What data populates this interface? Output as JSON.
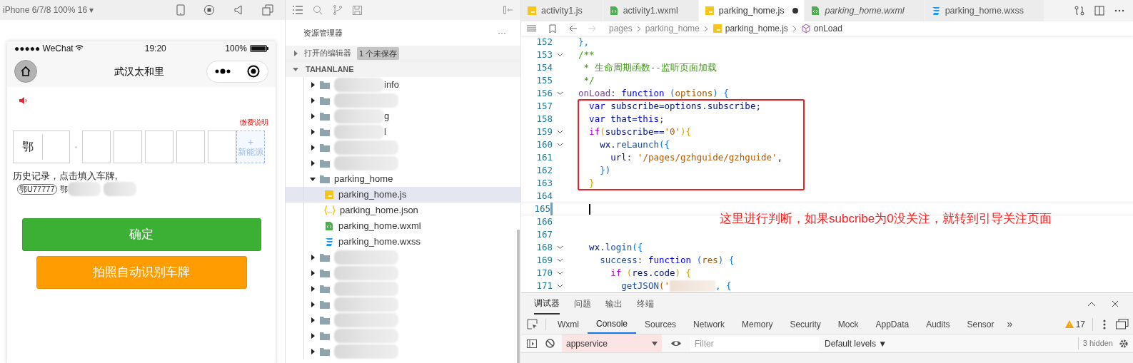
{
  "simulator": {
    "device_label": "iPhone 6/7/8 100% 16 ▾",
    "status": {
      "carrier": "●●●●● WeChat",
      "time": "19:20",
      "battery": "100%"
    },
    "nav_title": "武汉太和里",
    "fee_link": "缴费说明",
    "plate": {
      "province": "鄂",
      "new_energy_plus": "+",
      "new_energy_label": "新能源"
    },
    "history_label": "历史记录，点击填入车牌,",
    "history": [
      {
        "text": "鄂U77777",
        "redacted": false
      },
      {
        "text": "鄂",
        "redacted": true
      },
      {
        "redacted": true
      }
    ],
    "buttons": [
      {
        "label": "确定",
        "kind": "primary"
      },
      {
        "label": "拍照自动识别车牌",
        "kind": "warn"
      }
    ]
  },
  "explorer": {
    "title": "资源管理器",
    "more": "···",
    "open_editors": {
      "label": "打开的编辑器",
      "badge": "1 个未保存",
      "expanded": false
    },
    "project": {
      "label": "TAHANLANE",
      "expanded": true
    },
    "tree": [
      {
        "kind": "folder",
        "expanded": false,
        "redacted": true,
        "name": "info"
      },
      {
        "kind": "folder",
        "expanded": false,
        "redacted": true
      },
      {
        "kind": "folder",
        "expanded": false,
        "redacted": true,
        "name": "g"
      },
      {
        "kind": "folder",
        "expanded": false,
        "redacted": true,
        "name": "l"
      },
      {
        "kind": "folder",
        "expanded": false,
        "redacted": true
      },
      {
        "kind": "folder",
        "expanded": false,
        "redacted": true
      },
      {
        "kind": "folder",
        "expanded": true,
        "redacted": false,
        "name": "parking_home",
        "children": [
          {
            "kind": "js",
            "name": "parking_home.js",
            "selected": true
          },
          {
            "kind": "json",
            "name": "parking_home.json",
            "selected": false
          },
          {
            "kind": "wxml",
            "name": "parking_home.wxml",
            "selected": false
          },
          {
            "kind": "wxss",
            "name": "parking_home.wxss",
            "selected": false
          }
        ]
      },
      {
        "kind": "folder",
        "expanded": false,
        "redacted": true
      },
      {
        "kind": "folder",
        "expanded": false,
        "redacted": true
      },
      {
        "kind": "folder",
        "expanded": false,
        "redacted": true
      },
      {
        "kind": "folder",
        "expanded": false,
        "redacted": true
      },
      {
        "kind": "folder",
        "expanded": false,
        "redacted": true
      },
      {
        "kind": "folder",
        "expanded": false,
        "redacted": true
      },
      {
        "kind": "folder",
        "expanded": false,
        "redacted": true
      }
    ]
  },
  "editor": {
    "tabs": [
      {
        "label": "activity1.js",
        "kind": "js",
        "selected": false,
        "modified": false,
        "preview": false
      },
      {
        "label": "activity1.wxml",
        "kind": "wxml",
        "selected": false,
        "modified": false,
        "preview": false
      },
      {
        "label": "parking_home.js",
        "kind": "js",
        "selected": true,
        "modified": true,
        "preview": false
      },
      {
        "label": "parking_home.wxml",
        "kind": "wxml",
        "selected": false,
        "modified": false,
        "preview": true
      },
      {
        "label": "parking_home.wxss",
        "kind": "wxss",
        "selected": false,
        "modified": false,
        "preview": false
      }
    ],
    "breadcrumb": [
      {
        "text": "pages",
        "kind": "folder"
      },
      {
        "text": "parking_home",
        "kind": "folder"
      },
      {
        "text": "parking_home.js",
        "kind": "js"
      },
      {
        "text": "onLoad",
        "kind": "method"
      }
    ],
    "lines": [
      {
        "number": "152",
        "fold": false,
        "current": false,
        "tokens": [
          {
            "text": "  },",
            "kind": "bracket"
          }
        ]
      },
      {
        "number": "153",
        "fold": true,
        "current": false,
        "tokens": [
          {
            "text": "  /**",
            "kind": "comment"
          }
        ]
      },
      {
        "number": "154",
        "fold": false,
        "current": false,
        "tokens": [
          {
            "text": "   * 生命周期函数--监听页面加载",
            "kind": "comment"
          }
        ]
      },
      {
        "number": "155",
        "fold": false,
        "current": false,
        "tokens": [
          {
            "text": "   */",
            "kind": "comment"
          }
        ]
      },
      {
        "number": "156",
        "fold": true,
        "current": false,
        "tokens": [
          {
            "text": "  onLoad",
            "kind": "method"
          },
          {
            "text": ": ",
            "kind": "plain"
          },
          {
            "text": "function",
            "kind": "keyword"
          },
          {
            "text": " (",
            "kind": "bracket"
          },
          {
            "text": "options",
            "kind": "param"
          },
          {
            "text": ") {",
            "kind": "bracket"
          }
        ]
      },
      {
        "number": "157",
        "fold": false,
        "current": false,
        "tokens": [
          {
            "text": "    var",
            "kind": "keyword"
          },
          {
            "text": " subscribe=options.subscribe;",
            "kind": "variable"
          }
        ]
      },
      {
        "number": "158",
        "fold": false,
        "current": false,
        "tokens": [
          {
            "text": "    var",
            "kind": "keyword"
          },
          {
            "text": " that=",
            "kind": "variable"
          },
          {
            "text": "this",
            "kind": "keyword"
          },
          {
            "text": ";",
            "kind": "plain"
          }
        ]
      },
      {
        "number": "159",
        "fold": true,
        "current": false,
        "tokens": [
          {
            "text": "    if",
            "kind": "control"
          },
          {
            "text": "(",
            "kind": "gold"
          },
          {
            "text": "subscribe==",
            "kind": "variable"
          },
          {
            "text": "'0'",
            "kind": "string"
          },
          {
            "text": "){",
            "kind": "gold"
          }
        ]
      },
      {
        "number": "160",
        "fold": true,
        "current": false,
        "tokens": [
          {
            "text": "      wx.",
            "kind": "variable"
          },
          {
            "text": "reLaunch",
            "kind": "function"
          },
          {
            "text": "({",
            "kind": "bracket"
          }
        ]
      },
      {
        "number": "161",
        "fold": false,
        "current": false,
        "tokens": [
          {
            "text": "        url",
            "kind": "variable"
          },
          {
            "text": ": ",
            "kind": "plain"
          },
          {
            "text": "'/pages/gzhguide/gzhguide'",
            "kind": "string"
          },
          {
            "text": ",",
            "kind": "plain"
          }
        ]
      },
      {
        "number": "162",
        "fold": false,
        "current": false,
        "tokens": [
          {
            "text": "      })",
            "kind": "bracket"
          }
        ]
      },
      {
        "number": "163",
        "fold": false,
        "current": false,
        "tokens": [
          {
            "text": "    }",
            "kind": "gold"
          }
        ]
      },
      {
        "number": "164",
        "fold": false,
        "current": false
      },
      {
        "number": "165",
        "fold": false,
        "current": true
      },
      {
        "number": "166",
        "fold": false,
        "current": false
      },
      {
        "number": "167",
        "fold": false,
        "current": false
      },
      {
        "number": "168",
        "fold": true,
        "current": false,
        "tokens": [
          {
            "text": "    wx.",
            "kind": "variable"
          },
          {
            "text": "login",
            "kind": "function"
          },
          {
            "text": "({",
            "kind": "bracket"
          }
        ]
      },
      {
        "number": "169",
        "fold": true,
        "current": false,
        "tokens": [
          {
            "text": "      success",
            "kind": "function"
          },
          {
            "text": ": ",
            "kind": "plain"
          },
          {
            "text": "function",
            "kind": "keyword"
          },
          {
            "text": " (",
            "kind": "bracket"
          },
          {
            "text": "res",
            "kind": "param"
          },
          {
            "text": ") {",
            "kind": "bracket"
          }
        ]
      },
      {
        "number": "170",
        "fold": true,
        "current": false,
        "tokens": [
          {
            "text": "        if",
            "kind": "control"
          },
          {
            "text": " (",
            "kind": "gold"
          },
          {
            "text": "res.code",
            "kind": "variable"
          },
          {
            "text": ") {",
            "kind": "gold"
          }
        ]
      },
      {
        "number": "171",
        "fold": true,
        "current": false,
        "tokens": [
          {
            "text": "          getJSON",
            "kind": "function"
          },
          {
            "text": "('",
            "kind": "string"
          },
          {
            "kind": "redacted"
          },
          {
            "text": ", {",
            "kind": "bracket"
          }
        ]
      }
    ],
    "annotation": "这里进行判断，如果subcribe为0没关注，就转到引导关注页面"
  },
  "devtools": {
    "tabs": [
      {
        "label": "调试器",
        "selected": true
      },
      {
        "label": "问题",
        "selected": false
      },
      {
        "label": "输出",
        "selected": false
      },
      {
        "label": "终端",
        "selected": false
      }
    ],
    "panels": [
      {
        "label": "Wxml",
        "selected": false
      },
      {
        "label": "Console",
        "selected": true
      },
      {
        "label": "Sources",
        "selected": false
      },
      {
        "label": "Network",
        "selected": false
      },
      {
        "label": "Memory",
        "selected": false
      },
      {
        "label": "Security",
        "selected": false
      },
      {
        "label": "Mock",
        "selected": false
      },
      {
        "label": "AppData",
        "selected": false
      },
      {
        "label": "Audits",
        "selected": false
      },
      {
        "label": "Sensor",
        "selected": false
      }
    ],
    "more_panels": "»",
    "warnings": "17",
    "context": "appservice",
    "filter_placeholder": "Filter",
    "levels": "Default levels ▼",
    "hidden": "3 hidden"
  }
}
